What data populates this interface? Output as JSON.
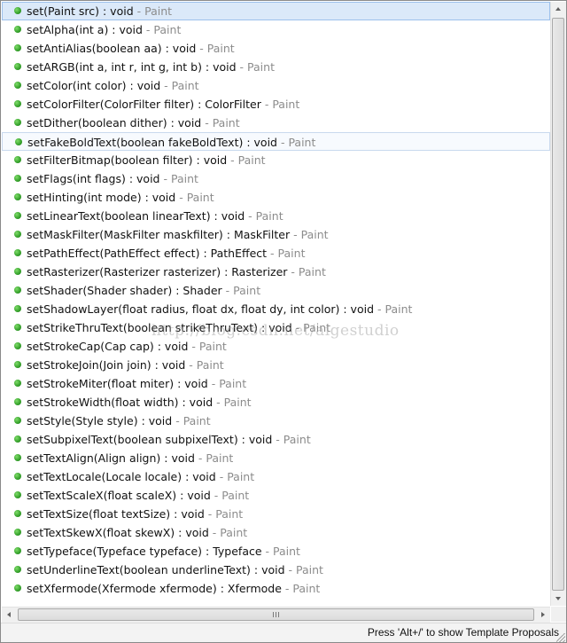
{
  "proposals": [
    {
      "signature": "set(Paint src) : void",
      "owner": "Paint"
    },
    {
      "signature": "setAlpha(int a) : void",
      "owner": "Paint"
    },
    {
      "signature": "setAntiAlias(boolean aa) : void",
      "owner": "Paint"
    },
    {
      "signature": "setARGB(int a, int r, int g, int b) : void",
      "owner": "Paint"
    },
    {
      "signature": "setColor(int color) : void",
      "owner": "Paint"
    },
    {
      "signature": "setColorFilter(ColorFilter filter) : ColorFilter",
      "owner": "Paint"
    },
    {
      "signature": "setDither(boolean dither) : void",
      "owner": "Paint"
    },
    {
      "signature": "setFakeBoldText(boolean fakeBoldText) : void",
      "owner": "Paint"
    },
    {
      "signature": "setFilterBitmap(boolean filter) : void",
      "owner": "Paint"
    },
    {
      "signature": "setFlags(int flags) : void",
      "owner": "Paint"
    },
    {
      "signature": "setHinting(int mode) : void",
      "owner": "Paint"
    },
    {
      "signature": "setLinearText(boolean linearText) : void",
      "owner": "Paint"
    },
    {
      "signature": "setMaskFilter(MaskFilter maskfilter) : MaskFilter",
      "owner": "Paint"
    },
    {
      "signature": "setPathEffect(PathEffect effect) : PathEffect",
      "owner": "Paint"
    },
    {
      "signature": "setRasterizer(Rasterizer rasterizer) : Rasterizer",
      "owner": "Paint"
    },
    {
      "signature": "setShader(Shader shader) : Shader",
      "owner": "Paint"
    },
    {
      "signature": "setShadowLayer(float radius, float dx, float dy, int color) : void",
      "owner": "Paint"
    },
    {
      "signature": "setStrikeThruText(boolean strikeThruText) : void",
      "owner": "Paint"
    },
    {
      "signature": "setStrokeCap(Cap cap) : void",
      "owner": "Paint"
    },
    {
      "signature": "setStrokeJoin(Join join) : void",
      "owner": "Paint"
    },
    {
      "signature": "setStrokeMiter(float miter) : void",
      "owner": "Paint"
    },
    {
      "signature": "setStrokeWidth(float width) : void",
      "owner": "Paint"
    },
    {
      "signature": "setStyle(Style style) : void",
      "owner": "Paint"
    },
    {
      "signature": "setSubpixelText(boolean subpixelText) : void",
      "owner": "Paint"
    },
    {
      "signature": "setTextAlign(Align align) : void",
      "owner": "Paint"
    },
    {
      "signature": "setTextLocale(Locale locale) : void",
      "owner": "Paint"
    },
    {
      "signature": "setTextScaleX(float scaleX) : void",
      "owner": "Paint"
    },
    {
      "signature": "setTextSize(float textSize) : void",
      "owner": "Paint"
    },
    {
      "signature": "setTextSkewX(float skewX) : void",
      "owner": "Paint"
    },
    {
      "signature": "setTypeface(Typeface typeface) : Typeface",
      "owner": "Paint"
    },
    {
      "signature": "setUnderlineText(boolean underlineText) : void",
      "owner": "Paint"
    },
    {
      "signature": "setXfermode(Xfermode xfermode) : Xfermode",
      "owner": "Paint"
    }
  ],
  "selected_index": 0,
  "hovered_index": 7,
  "separator": " - ",
  "icons": {
    "proposal_icon": "public-method-icon",
    "method_icon_color": "#34a02a"
  },
  "watermark": "http://blog.csdn.net/aigestudio",
  "status_hint": "Press 'Alt+/' to show Template Proposals",
  "colors": {
    "selection_bg": "#dbe9f9",
    "owner_text": "#8c8c8c"
  }
}
